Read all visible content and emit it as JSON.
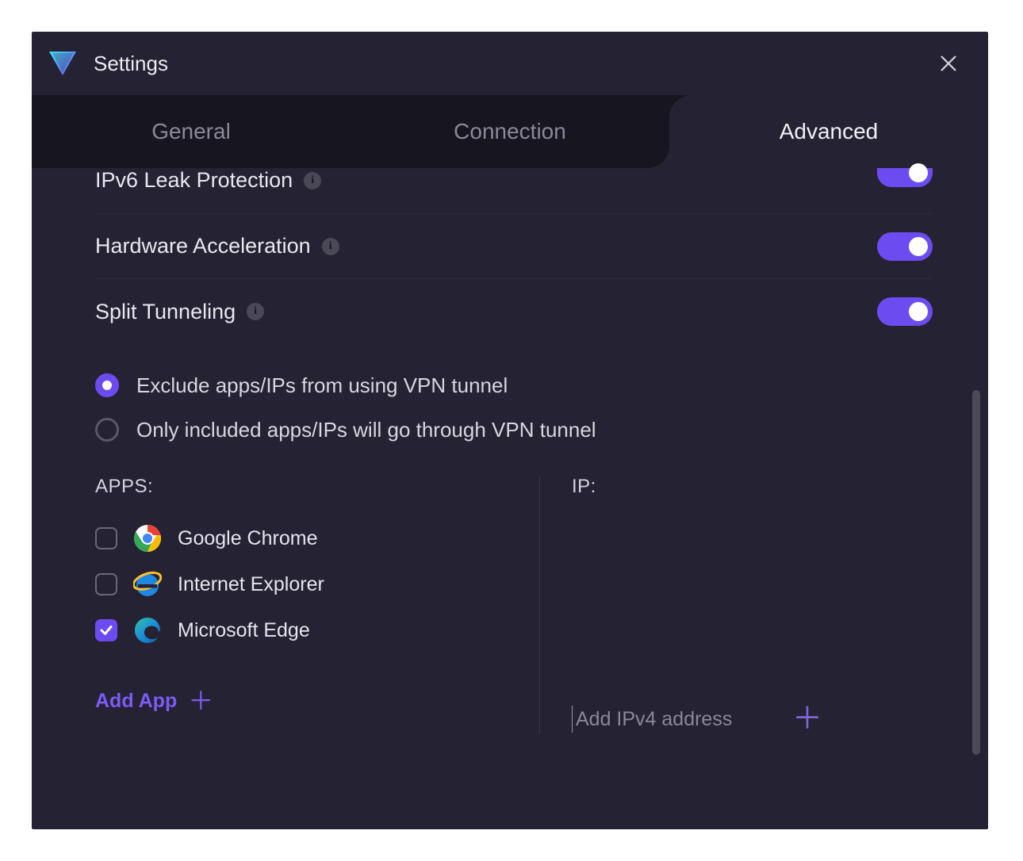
{
  "window": {
    "title": "Settings"
  },
  "tabs": [
    {
      "label": "General",
      "active": false
    },
    {
      "label": "Connection",
      "active": false
    },
    {
      "label": "Advanced",
      "active": true
    }
  ],
  "settings": {
    "ipv6": {
      "label": "IPv6 Leak Protection",
      "enabled": true
    },
    "hwaccel": {
      "label": "Hardware Acceleration",
      "enabled": true
    },
    "split": {
      "label": "Split Tunneling",
      "enabled": true
    }
  },
  "split_mode": {
    "options": [
      {
        "label": "Exclude apps/IPs from using VPN tunnel",
        "selected": true
      },
      {
        "label": "Only included apps/IPs will go through VPN tunnel",
        "selected": false
      }
    ]
  },
  "apps": {
    "header": "APPS:",
    "items": [
      {
        "name": "Google Chrome",
        "checked": false,
        "icon": "chrome-icon"
      },
      {
        "name": "Internet Explorer",
        "checked": false,
        "icon": "ie-icon"
      },
      {
        "name": "Microsoft Edge",
        "checked": true,
        "icon": "edge-icon"
      }
    ],
    "add_label": "Add App"
  },
  "ip": {
    "header": "IP:",
    "placeholder": "Add IPv4 address"
  },
  "colors": {
    "accent": "#6C4CF1"
  }
}
